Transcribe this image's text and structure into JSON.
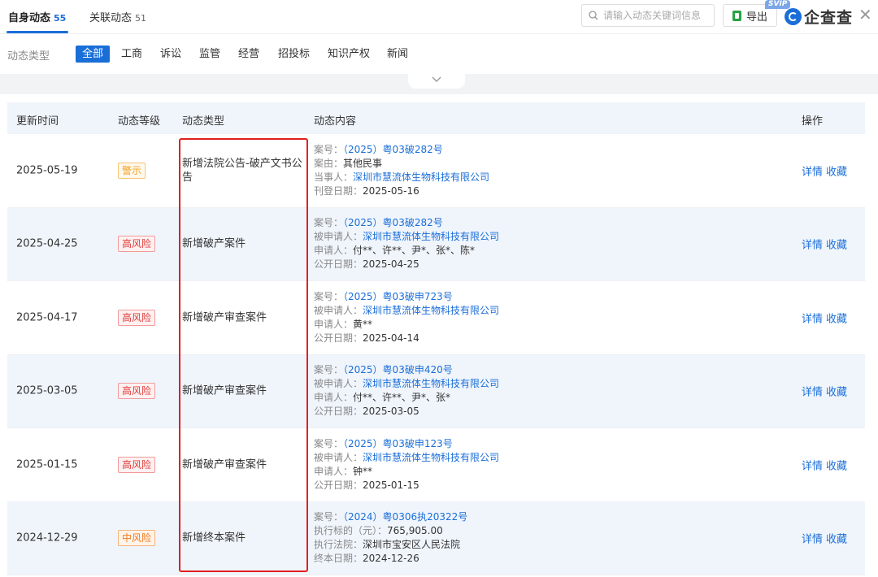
{
  "tabs": [
    {
      "label": "自身动态",
      "count": "55"
    },
    {
      "label": "关联动态",
      "count": "51"
    }
  ],
  "search": {
    "placeholder": "请输入动态关键词信息"
  },
  "toolbar": {
    "export_label": "导出",
    "svip_badge": "SVIP"
  },
  "brand": {
    "name": "企查查"
  },
  "filter": {
    "label": "动态类型",
    "options": [
      "全部",
      "工商",
      "诉讼",
      "监管",
      "经营",
      "招投标",
      "知识产权",
      "新闻"
    ],
    "selected": "全部"
  },
  "table": {
    "headers": [
      "更新时间",
      "动态等级",
      "动态类型",
      "动态内容",
      "操作"
    ],
    "actions": [
      "详情",
      "收藏"
    ],
    "rows": [
      {
        "date": "2025-05-19",
        "level": "警示",
        "level_kind": "warn",
        "type": "新增法院公告-破产文书公告",
        "lines": [
          {
            "k": "案号：",
            "v": "（2025）粤03破282号",
            "link": true
          },
          {
            "k": "案由：",
            "v": "其他民事",
            "link": false
          },
          {
            "k": "当事人：",
            "v": "深圳市慧流体生物科技有限公司",
            "link": true
          },
          {
            "k": "刊登日期：",
            "v": "2025-05-16",
            "link": false
          }
        ]
      },
      {
        "date": "2025-04-25",
        "level": "高风险",
        "level_kind": "high",
        "type": "新增破产案件",
        "lines": [
          {
            "k": "案号：",
            "v": "（2025）粤03破282号",
            "link": true
          },
          {
            "k": "被申请人：",
            "v": "深圳市慧流体生物科技有限公司",
            "link": true
          },
          {
            "k": "申请人：",
            "v": "付**、许**、尹*、张*、陈*",
            "link": false
          },
          {
            "k": "公开日期：",
            "v": "2025-04-25",
            "link": false
          }
        ]
      },
      {
        "date": "2025-04-17",
        "level": "高风险",
        "level_kind": "high",
        "type": "新增破产审查案件",
        "lines": [
          {
            "k": "案号：",
            "v": "（2025）粤03破申723号",
            "link": true
          },
          {
            "k": "被申请人：",
            "v": "深圳市慧流体生物科技有限公司",
            "link": true
          },
          {
            "k": "申请人：",
            "v": "黄**",
            "link": false
          },
          {
            "k": "公开日期：",
            "v": "2025-04-14",
            "link": false
          }
        ]
      },
      {
        "date": "2025-03-05",
        "level": "高风险",
        "level_kind": "high",
        "type": "新增破产审查案件",
        "lines": [
          {
            "k": "案号：",
            "v": "（2025）粤03破申420号",
            "link": true
          },
          {
            "k": "被申请人：",
            "v": "深圳市慧流体生物科技有限公司",
            "link": true
          },
          {
            "k": "申请人：",
            "v": "付**、许**、尹*、张*",
            "link": false
          },
          {
            "k": "公开日期：",
            "v": "2025-03-05",
            "link": false
          }
        ]
      },
      {
        "date": "2025-01-15",
        "level": "高风险",
        "level_kind": "high",
        "type": "新增破产审查案件",
        "lines": [
          {
            "k": "案号：",
            "v": "（2025）粤03破申123号",
            "link": true
          },
          {
            "k": "被申请人：",
            "v": "深圳市慧流体生物科技有限公司",
            "link": true
          },
          {
            "k": "申请人：",
            "v": "钟**",
            "link": false
          },
          {
            "k": "公开日期：",
            "v": "2025-01-15",
            "link": false
          }
        ]
      },
      {
        "date": "2024-12-29",
        "level": "中风险",
        "level_kind": "mid",
        "type": "新增终本案件",
        "lines": [
          {
            "k": "案号：",
            "v": "（2024）粤0306执20322号",
            "link": true
          },
          {
            "k": "执行标的（元）：",
            "v": "765,905.00",
            "link": false
          },
          {
            "k": "执行法院：",
            "v": "深圳市宝安区人民法院",
            "link": false
          },
          {
            "k": "终本日期：",
            "v": "2024-12-26",
            "link": false
          }
        ]
      }
    ]
  },
  "colors": {
    "accent": "#1a6ed8",
    "highlight": "#e02020"
  }
}
